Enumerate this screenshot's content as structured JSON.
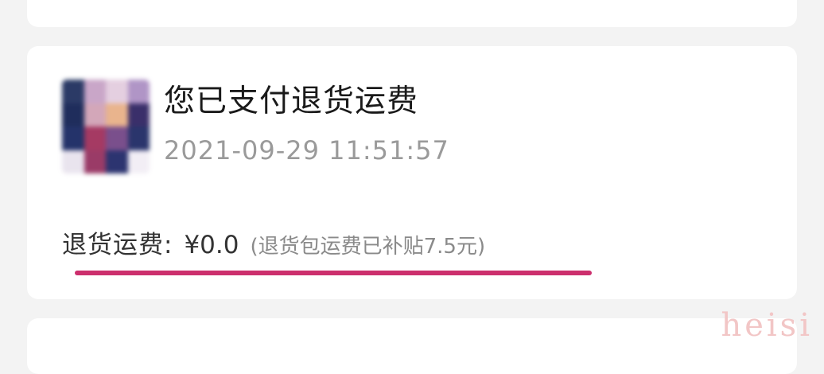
{
  "notice": {
    "title": "您已支付退货运费",
    "timestamp": "2021-09-29 11:51:57",
    "fee_label": "退货运费:",
    "fee_amount": "¥0.0",
    "fee_note": "(退货包运费已补贴7.5元)"
  },
  "watermark": "heisi",
  "colors": {
    "underline": "#cc2f6d",
    "watermark": "#f2c6c6"
  },
  "thumbnail": {
    "state": "pixelated-blurred"
  }
}
